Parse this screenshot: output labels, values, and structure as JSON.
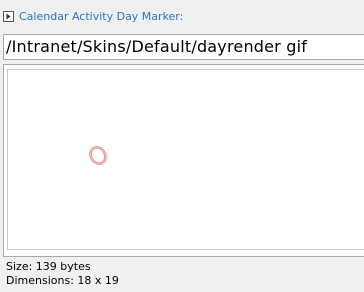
{
  "panel": {
    "title": "Calendar Activity Day Marker:",
    "path_value": "/Intranet/Skins/Default/dayrender gif",
    "size_text": "Size: 139 bytes",
    "dimensions_text": "Dimensions: 18 x 19",
    "title_color": "#2f73c4"
  },
  "icons": {
    "expander": "expand-arrow-icon",
    "preview": "ring-image"
  },
  "colors": {
    "ring": "#e58a8a"
  }
}
